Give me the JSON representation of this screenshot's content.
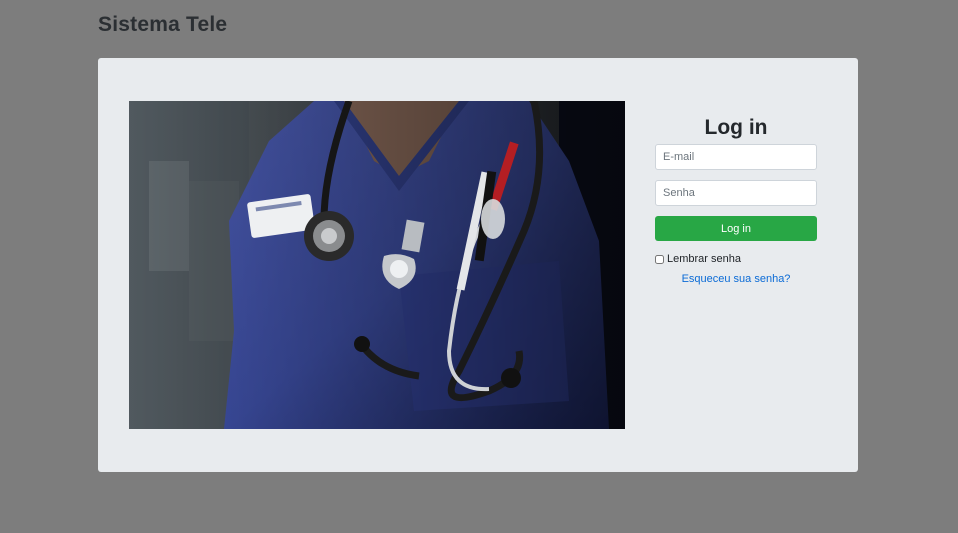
{
  "app": {
    "title": "Sistema Tele"
  },
  "login": {
    "title": "Log in",
    "email_placeholder": "E-mail",
    "password_placeholder": "Senha",
    "submit_label": "Log in",
    "remember_label": "Lembrar senha",
    "remember_checked": false,
    "forgot_link": "Esqueceu sua senha?"
  },
  "colors": {
    "page_bg": "#7d7d7d",
    "card_bg": "#e8ebee",
    "submit_bg": "#28a745",
    "link": "#0b6bd6"
  }
}
